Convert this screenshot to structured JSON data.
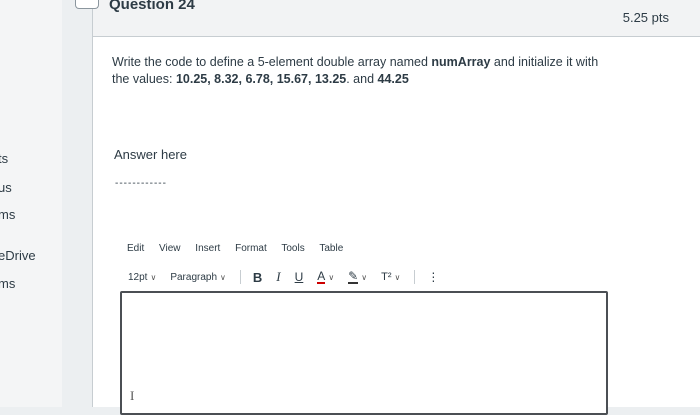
{
  "left_nav": {
    "items": [
      "ts",
      "us",
      "ms",
      "eDrive",
      "ms"
    ]
  },
  "question": {
    "title": "Question 24",
    "points": "5.25 pts",
    "text_parts": {
      "p1": "Write the code to define a 5-element double array named ",
      "p2": "numArray",
      "p3": " and initialize it with the values: ",
      "p4": "10.25, 8.32, 6.78, 15.67, 13.25",
      "p5": ". and ",
      "p6": "44.25"
    }
  },
  "answer": {
    "label": "Answer here",
    "dashes": "------------"
  },
  "editor": {
    "menu": [
      "Edit",
      "View",
      "Insert",
      "Format",
      "Tools",
      "Table"
    ],
    "font_size": "12pt",
    "paragraph": "Paragraph",
    "bold": "B",
    "italic": "I",
    "underline": "U",
    "text_color": "A",
    "highlight": "✎",
    "superscript": "T²",
    "more": "⋮",
    "cursor": "I"
  }
}
